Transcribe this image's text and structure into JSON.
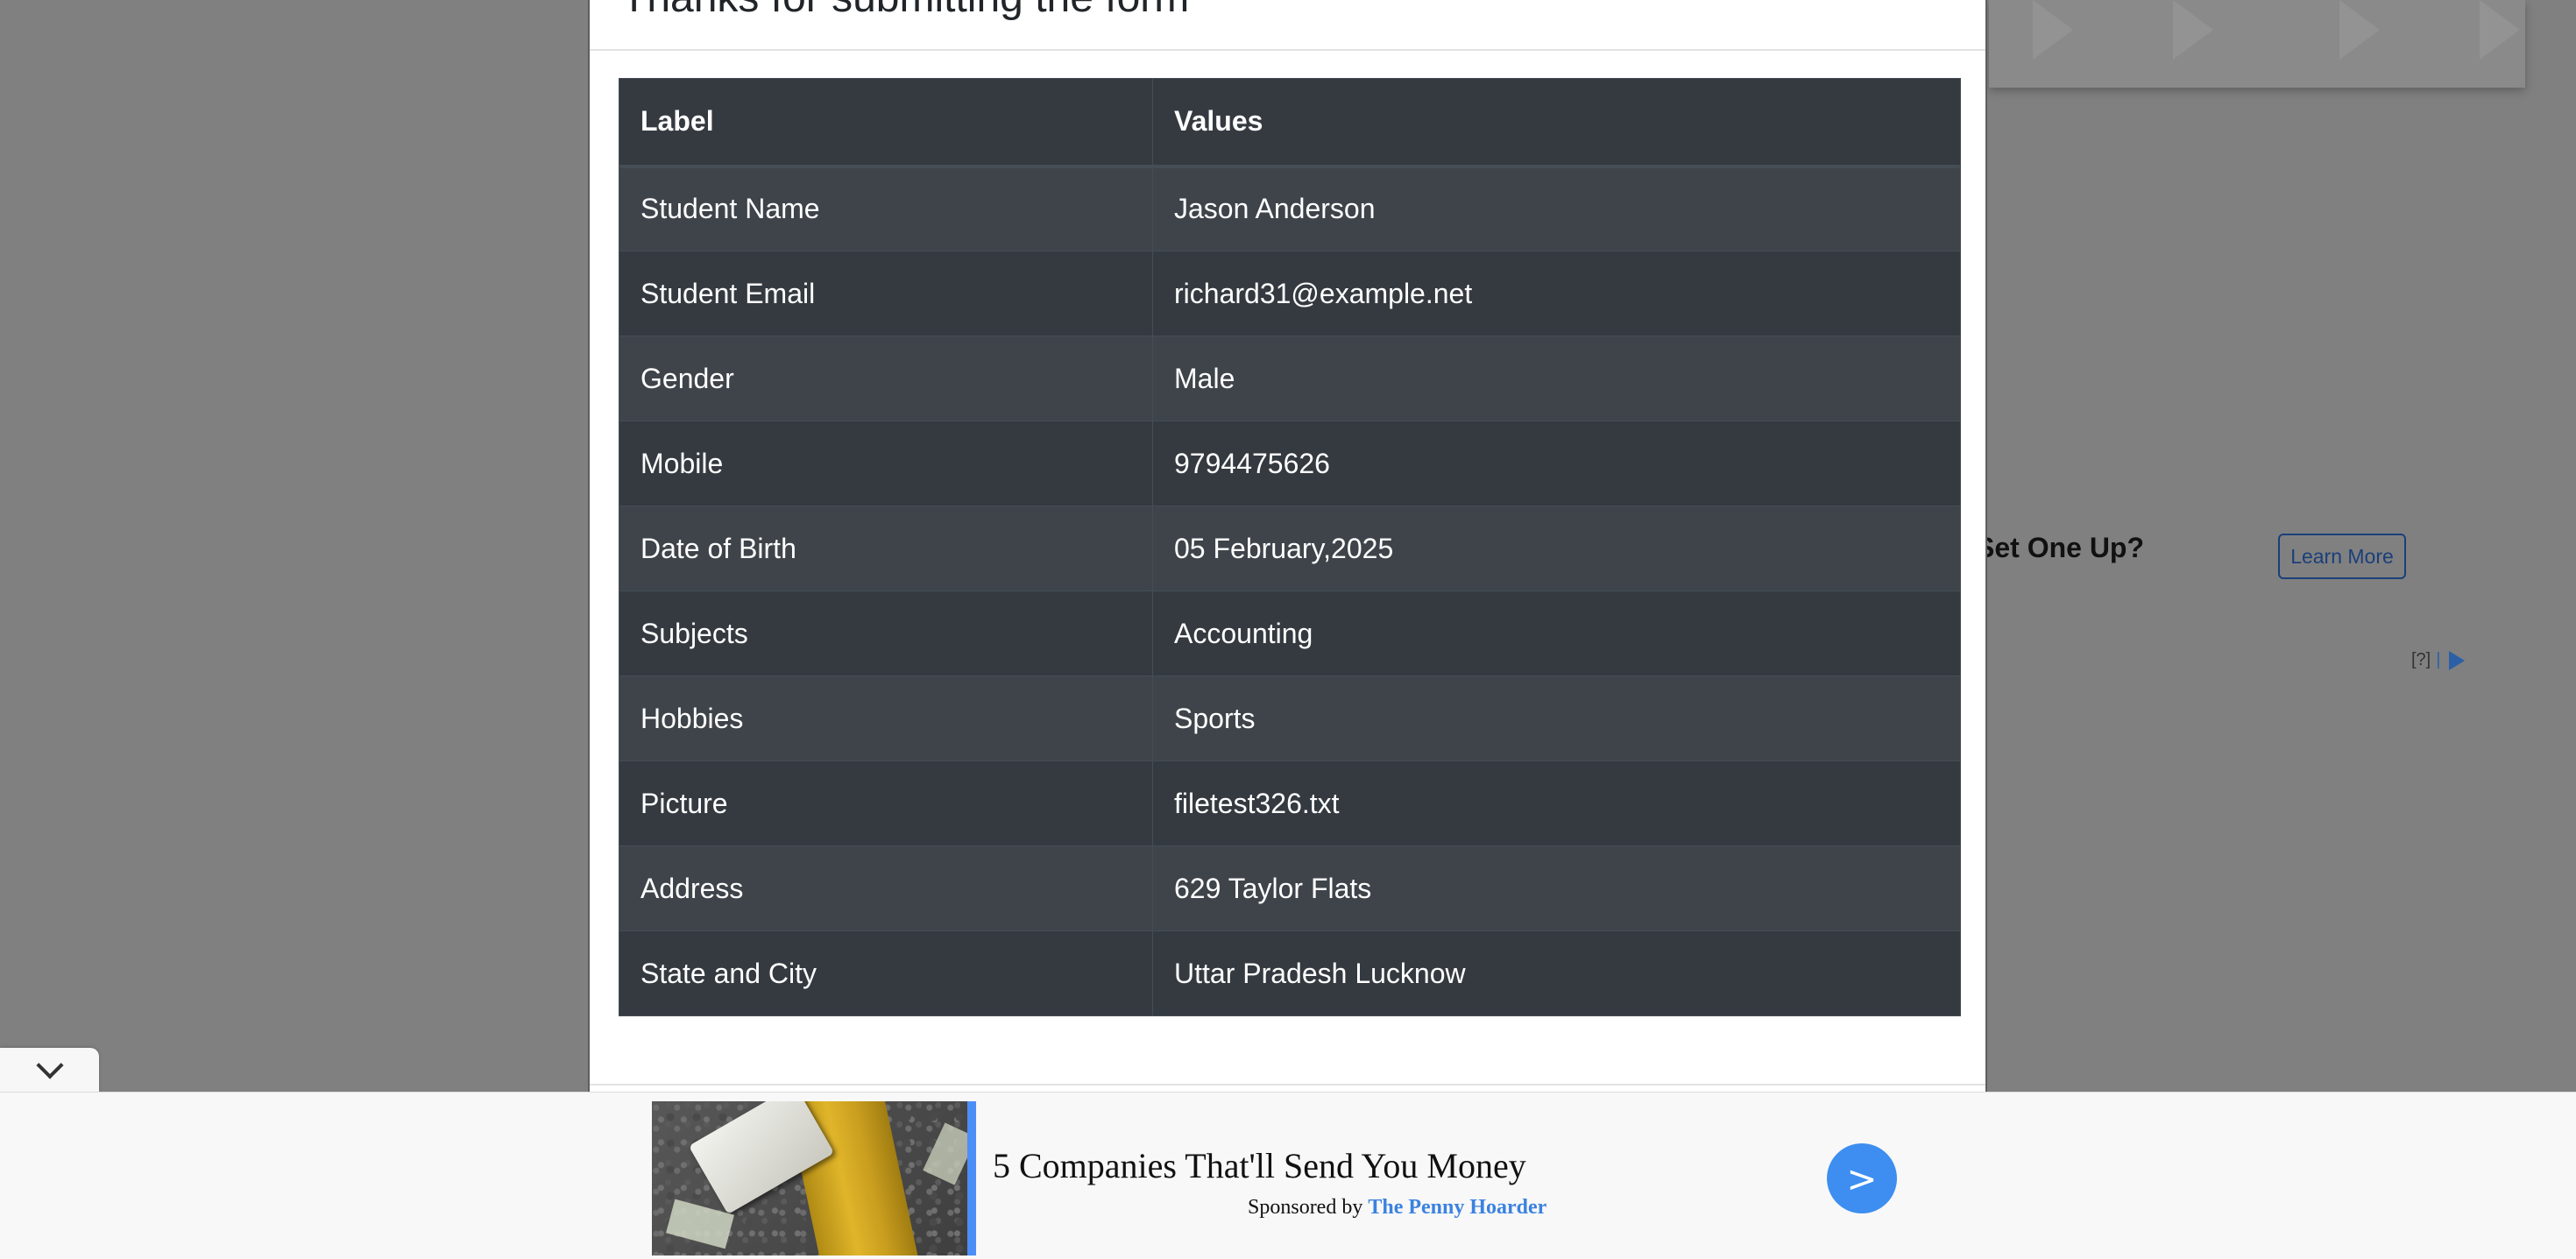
{
  "modal": {
    "title": "Thanks for submitting the form",
    "table": {
      "headers": [
        "Label",
        "Values"
      ],
      "rows": [
        {
          "label": "Student Name",
          "value": "Jason Anderson"
        },
        {
          "label": "Student Email",
          "value": "richard31@example.net"
        },
        {
          "label": "Gender",
          "value": "Male"
        },
        {
          "label": "Mobile",
          "value": "9794475626"
        },
        {
          "label": "Date of Birth",
          "value": "05 February,2025"
        },
        {
          "label": "Subjects",
          "value": "Accounting"
        },
        {
          "label": "Hobbies",
          "value": "Sports"
        },
        {
          "label": "Picture",
          "value": "filetest326.txt"
        },
        {
          "label": "Address",
          "value": "629 Taylor Flats"
        },
        {
          "label": "State and City",
          "value": "Uttar Pradesh Lucknow"
        }
      ]
    }
  },
  "background_ad": {
    "headline_fragment": "Set One Up?",
    "learn_more_label": "Learn More",
    "help_label": "[?]"
  },
  "bottom_ad": {
    "headline": "5 Companies That'll Send You Money",
    "sponsored_prefix": "Sponsored by",
    "sponsor_name": "The Penny Hoarder",
    "go_label": ">",
    "accent_color": "#4c8ef7"
  },
  "collapse_tab": {
    "icon": "chevron-down-icon"
  }
}
